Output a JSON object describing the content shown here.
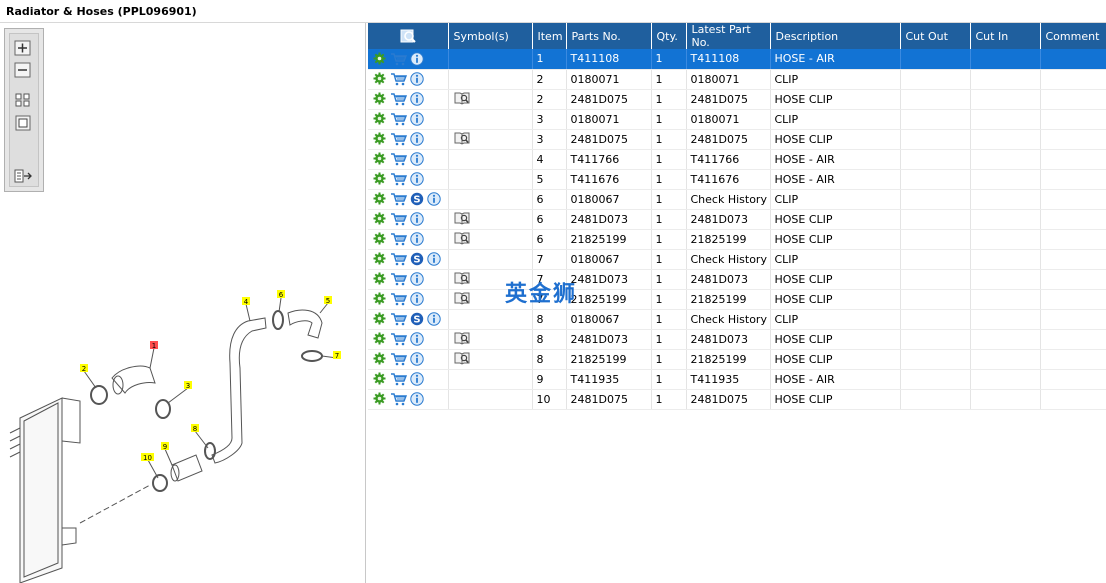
{
  "window": {
    "title": "Radiator & Hoses (PPL096901)"
  },
  "colors": {
    "header_bg": "#1f5f9e",
    "selected_row": "#1273d4",
    "gear_green": "#3a9b23",
    "cart_blue": "#2a7bd0",
    "info_blue": "#2a7bd0",
    "callout_yellow": "#ffff00",
    "callout_red": "#ff4d4d"
  },
  "toolbar": {
    "zoom_in": "zoom-in-icon",
    "zoom_out": "zoom-out-icon",
    "fit_all": "fit-all-icon",
    "fit_window": "fit-window-icon",
    "export": "export-icon"
  },
  "diagram": {
    "callouts": [
      "1",
      "2",
      "3",
      "4",
      "5",
      "6",
      "7",
      "8",
      "9",
      "10"
    ]
  },
  "table": {
    "columns": [
      "",
      "Symbol(s)",
      "Item",
      "Parts No.",
      "Qty.",
      "Latest Part No.",
      "Description",
      "Cut Out",
      "Cut In",
      "Comment"
    ],
    "rows": [
      {
        "icons": [
          "gear",
          "cart",
          "info"
        ],
        "symbol": "",
        "item": "1",
        "part": "T411108",
        "qty": "1",
        "latest": "T411108",
        "desc": "HOSE - AIR",
        "selected": true
      },
      {
        "icons": [
          "gear",
          "cart",
          "info"
        ],
        "symbol": "",
        "item": "2",
        "part": "0180071",
        "qty": "1",
        "latest": "0180071",
        "desc": "CLIP"
      },
      {
        "icons": [
          "gear",
          "cart",
          "info"
        ],
        "symbol": "book",
        "item": "2",
        "part": "2481D075",
        "qty": "1",
        "latest": "2481D075",
        "desc": "HOSE CLIP"
      },
      {
        "icons": [
          "gear",
          "cart",
          "info"
        ],
        "symbol": "",
        "item": "3",
        "part": "0180071",
        "qty": "1",
        "latest": "0180071",
        "desc": "CLIP"
      },
      {
        "icons": [
          "gear",
          "cart",
          "info"
        ],
        "symbol": "book",
        "item": "3",
        "part": "2481D075",
        "qty": "1",
        "latest": "2481D075",
        "desc": "HOSE CLIP"
      },
      {
        "icons": [
          "gear",
          "cart",
          "info"
        ],
        "symbol": "",
        "item": "4",
        "part": "T411766",
        "qty": "1",
        "latest": "T411766",
        "desc": "HOSE - AIR"
      },
      {
        "icons": [
          "gear",
          "cart",
          "info"
        ],
        "symbol": "",
        "item": "5",
        "part": "T411676",
        "qty": "1",
        "latest": "T411676",
        "desc": "HOSE - AIR"
      },
      {
        "icons": [
          "gear",
          "cart",
          "s",
          "info"
        ],
        "symbol": "",
        "item": "6",
        "part": "0180067",
        "qty": "1",
        "latest": "Check History",
        "desc": "CLIP"
      },
      {
        "icons": [
          "gear",
          "cart",
          "info"
        ],
        "symbol": "book",
        "item": "6",
        "part": "2481D073",
        "qty": "1",
        "latest": "2481D073",
        "desc": "HOSE CLIP"
      },
      {
        "icons": [
          "gear",
          "cart",
          "info"
        ],
        "symbol": "book",
        "item": "6",
        "part": "21825199",
        "qty": "1",
        "latest": "21825199",
        "desc": "HOSE CLIP"
      },
      {
        "icons": [
          "gear",
          "cart",
          "s",
          "info"
        ],
        "symbol": "",
        "item": "7",
        "part": "0180067",
        "qty": "1",
        "latest": "Check History",
        "desc": "CLIP"
      },
      {
        "icons": [
          "gear",
          "cart",
          "info"
        ],
        "symbol": "book",
        "item": "7",
        "part": "2481D073",
        "qty": "1",
        "latest": "2481D073",
        "desc": "HOSE CLIP"
      },
      {
        "icons": [
          "gear",
          "cart",
          "info"
        ],
        "symbol": "book",
        "item": "7",
        "part": "21825199",
        "qty": "1",
        "latest": "21825199",
        "desc": "HOSE CLIP"
      },
      {
        "icons": [
          "gear",
          "cart",
          "s",
          "info"
        ],
        "symbol": "",
        "item": "8",
        "part": "0180067",
        "qty": "1",
        "latest": "Check History",
        "desc": "CLIP"
      },
      {
        "icons": [
          "gear",
          "cart",
          "info"
        ],
        "symbol": "book",
        "item": "8",
        "part": "2481D073",
        "qty": "1",
        "latest": "2481D073",
        "desc": "HOSE CLIP"
      },
      {
        "icons": [
          "gear",
          "cart",
          "info"
        ],
        "symbol": "book",
        "item": "8",
        "part": "21825199",
        "qty": "1",
        "latest": "21825199",
        "desc": "HOSE CLIP"
      },
      {
        "icons": [
          "gear",
          "cart",
          "info"
        ],
        "symbol": "",
        "item": "9",
        "part": "T411935",
        "qty": "1",
        "latest": "T411935",
        "desc": "HOSE - AIR"
      },
      {
        "icons": [
          "gear",
          "cart",
          "info"
        ],
        "symbol": "",
        "item": "10",
        "part": "2481D075",
        "qty": "1",
        "latest": "2481D075",
        "desc": "HOSE CLIP"
      }
    ]
  },
  "watermark": "英金狮"
}
